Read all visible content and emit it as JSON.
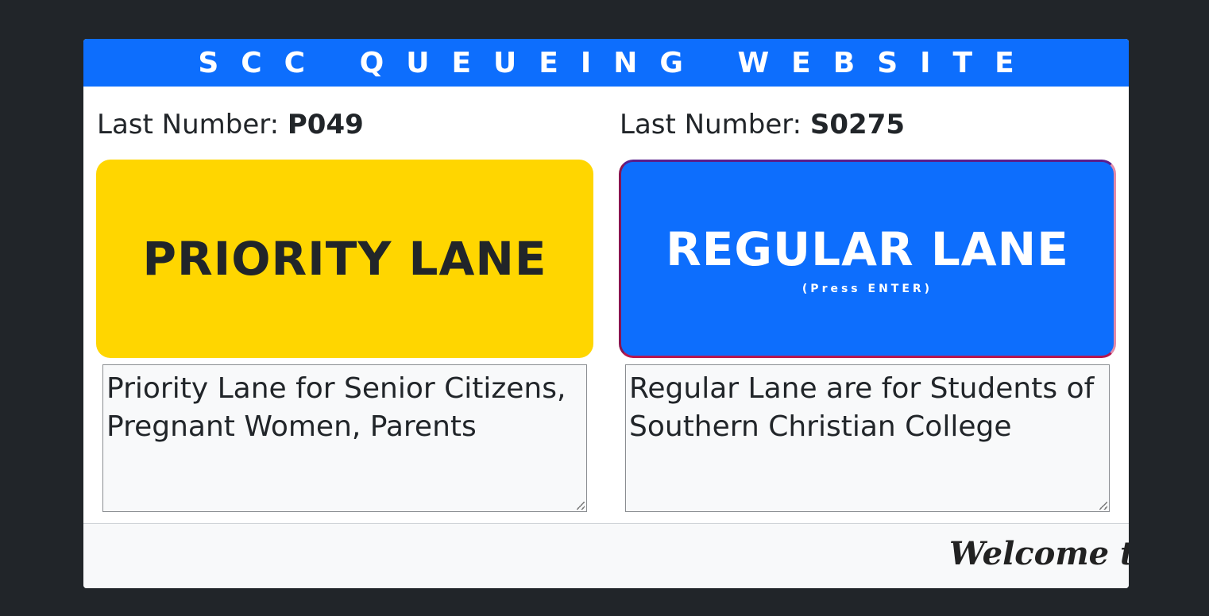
{
  "header": {
    "title": "SCC QUEUEING WEBSITE"
  },
  "priority": {
    "last_number_label": "Last Number:",
    "last_number": "P049",
    "button_label": "PRIORITY LANE",
    "description": "Priority Lane for Senior Citizens, Pregnant Women, Parents"
  },
  "regular": {
    "last_number_label": "Last Number:",
    "last_number": "S0275",
    "button_label": "REGULAR LANE",
    "button_hint": "(Press ENTER)",
    "description": "Regular Lane are for Students of Southern Christian College"
  },
  "footer": {
    "marquee": "Welcome to"
  },
  "colors": {
    "page_bg": "#212529",
    "header_bg": "#0d6efd",
    "priority_bg": "#ffd600",
    "regular_bg": "#0d6efd"
  }
}
